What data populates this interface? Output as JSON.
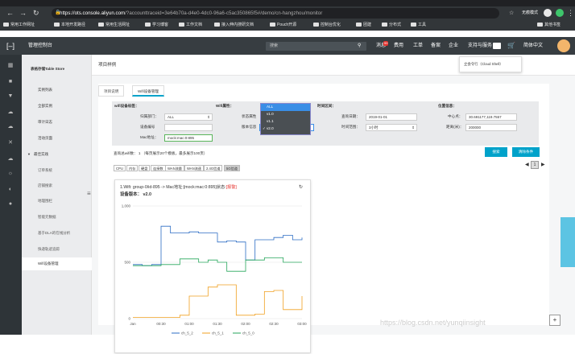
{
  "browser": {
    "url_host": "https://ots.console.aliyun.com",
    "url_path": "/?accounttraceid=3e64b70a-d4e0-4dc0-96a6-c5ac350865f5#/demo/cn-hangzhou/monitor",
    "incognito_label": "无痕模式",
    "bookmarks": [
      "常用工作网址",
      "本地开发路径",
      "常用生活网址",
      "学习博客",
      "工作文档",
      "接入伸内搜研文档",
      "Pouch开源",
      "控制台优化",
      "团建",
      "分布式",
      "工具"
    ],
    "bookmark_right": "其他书签"
  },
  "topnav": {
    "console_label": "管理控制台",
    "search_placeholder": "搜索",
    "items": [
      "消息",
      "费用",
      "工单",
      "备案",
      "企业",
      "支持与服务",
      "",
      "",
      "简体中文"
    ],
    "msg_badge": "99"
  },
  "sidebar": {
    "title": "表格存储Table Store",
    "items": [
      "实例列表",
      "全部实例",
      "审计日志",
      "活动页面"
    ],
    "section": "最佳实践",
    "sub_items": [
      "订单系统",
      "店铺搜索",
      "地理围栏",
      "智能元数据",
      "基于DLA的在线分析",
      "快递轨迹追踪",
      "Wifi设备管理"
    ]
  },
  "content": {
    "heading": "项目样例",
    "tooltip": "立会令行（Cloud Shell）",
    "tabs": [
      "项目说明",
      "Wifi设备管理"
    ],
    "wifi_label": "wifi设备标签：",
    "dept_label": "归属部门：",
    "dept_value": "ALL",
    "device_no_label": "设备编号",
    "device_no_value": "",
    "mac_label": "Mac地址：",
    "mac_value": "mock:mac:0:895",
    "wifi_attr_label": "Wifi属性：",
    "status_label": "状态属性",
    "version_label": "版本信息",
    "version_options": [
      "ALL",
      "v1.0",
      "v1.1",
      "v2.0"
    ],
    "time_label": "时间区间：",
    "query_date_label": "查询日期：",
    "query_date_value": "2019-01-01",
    "time_range_label": "时间范围：",
    "time_range_value": "3小时",
    "loc_label": "位置信息：",
    "center_label": "中心点：",
    "center_value": "30.691177,119.7557",
    "distance_label": "距离(米)：",
    "distance_value": "200000",
    "search_btn": "搜索",
    "clear_btn": "清除条件",
    "result_text": "查询总wifi数： 1 （每页展示20个模板，最多展示100页）",
    "page_num": "1",
    "metrics": [
      "CPU",
      "内存",
      "硬盘",
      "连接数",
      "WAN流量",
      "WAN流速",
      "2.4G信道",
      "5G信道"
    ],
    "card_title": "1.Wifi:  group-0/id-895 -> Mac地址:[mock:mac:0:895]状态:",
    "card_status": "[报警]",
    "card_version": "设备版本： v2.0"
  },
  "chart_data": {
    "type": "line",
    "x": [
      "Jan",
      "00:30",
      "01:00",
      "01:30",
      "02:00",
      "02:30",
      "03:00"
    ],
    "yticks": [
      "1,000",
      "500",
      "0"
    ],
    "ylim": [
      0,
      1000
    ],
    "series": [
      {
        "name": "ch_5_2",
        "color": "#2b6cc4",
        "values": [
          480,
          470,
          480,
          820,
          760,
          760,
          770,
          760,
          760,
          680,
          690,
          680,
          520,
          700,
          700,
          720,
          740,
          700,
          720
        ]
      },
      {
        "name": "ch_5_1",
        "color": "#f0a020",
        "values": [
          10,
          10,
          10,
          10,
          10,
          30,
          200,
          200,
          280,
          300,
          300,
          30,
          30,
          40,
          240,
          250,
          80,
          80,
          200
        ]
      },
      {
        "name": "ch_5_0",
        "color": "#26a65b",
        "values": [
          470,
          470,
          470,
          480,
          480,
          530,
          530,
          500,
          520,
          500,
          420,
          420,
          520,
          520,
          540,
          540,
          500,
          500,
          500
        ]
      }
    ]
  },
  "watermark": "https://blog.csdn.net/yunqiinsight"
}
